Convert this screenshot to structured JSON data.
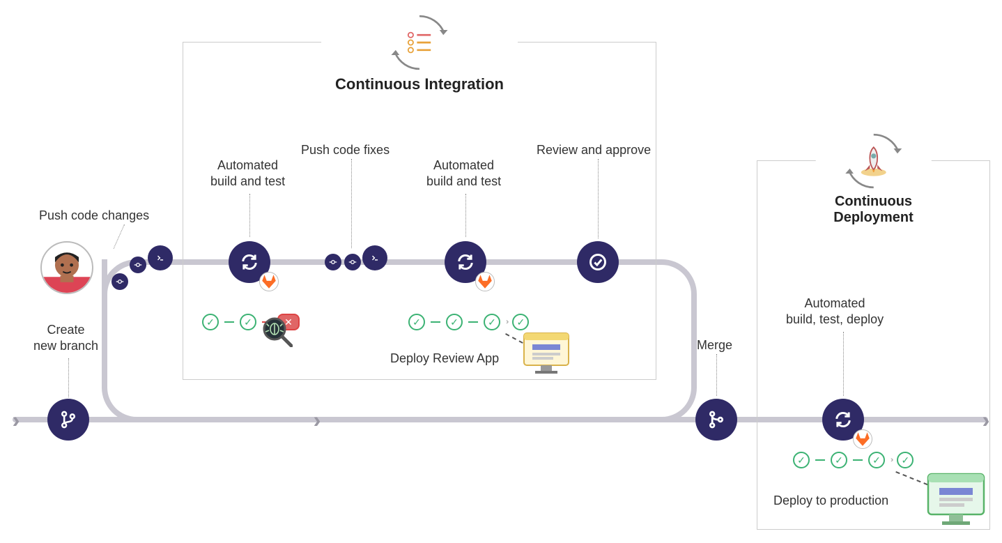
{
  "zones": {
    "ci": {
      "title": "Continuous Integration"
    },
    "cd": {
      "title": "Continuous Deployment"
    }
  },
  "nodes": {
    "create_branch": {
      "label": "Create\nnew branch"
    },
    "push_changes": {
      "label": "Push code changes"
    },
    "build_test_1": {
      "label": "Automated\nbuild and test"
    },
    "push_fixes": {
      "label": "Push code fixes"
    },
    "build_test_2": {
      "label": "Automated\nbuild and test"
    },
    "review_approve": {
      "label": "Review and approve"
    },
    "merge": {
      "label": "Merge"
    },
    "build_test_deploy": {
      "label": "Automated\nbuild, test, deploy"
    }
  },
  "deploy": {
    "review_app": "Deploy Review App",
    "production": "Deploy to production"
  },
  "status_sequences": {
    "seq1": [
      "pass",
      "pass",
      "fail"
    ],
    "seq2": [
      "pass",
      "pass",
      "pass",
      "chev",
      "pass"
    ],
    "seq3": [
      "pass",
      "pass",
      "pass",
      "chev",
      "pass"
    ]
  },
  "icons": {
    "branch": "branch-icon",
    "terminal": "terminal-icon",
    "cycle": "cycle-icon",
    "check": "check-icon",
    "merge": "merge-icon",
    "gitlab": "gitlab-icon",
    "rocket": "rocket-icon",
    "checklist": "checklist-icon",
    "bug": "bug-magnifier-icon",
    "monitor_yellow": "monitor-yellow-icon",
    "monitor_green": "monitor-green-icon",
    "avatar": "person-avatar-icon",
    "commit": "commit-dot-icon"
  },
  "colors": {
    "node": "#2f2a66",
    "track": "#c9c7d1",
    "pass": "#3bb273",
    "fail": "#e06666"
  }
}
